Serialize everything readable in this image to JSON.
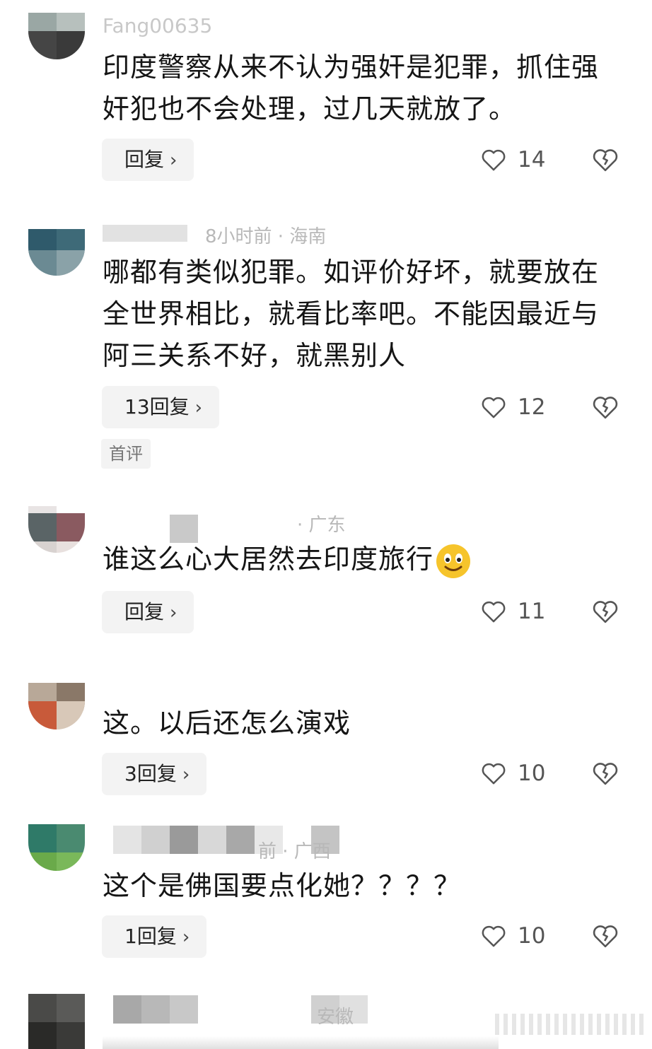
{
  "comments": [
    {
      "username": "Fang00635",
      "meta": "",
      "text": "印度警察从来不认为强奸是犯罪，抓住强奸犯也不会处理，过几天就放了。",
      "reply_label": "回复",
      "like_count": "14",
      "tag": ""
    },
    {
      "username": "",
      "meta": "8小时前 · 海南",
      "text": "哪都有类似犯罪。如评价好坏，就要放在全世界相比，就看比率吧。不能因最近与阿三关系不好，就黑别人",
      "reply_label": "13回复",
      "like_count": "12",
      "tag": "首评"
    },
    {
      "username": "",
      "meta": "· 广东",
      "text": "谁这么心大居然去印度旅行",
      "emoji": "smiling-face",
      "reply_label": "回复",
      "like_count": "11",
      "tag": ""
    },
    {
      "username": "",
      "meta": "",
      "text": "这。以后还怎么演戏",
      "reply_label": "3回复",
      "like_count": "10",
      "tag": ""
    },
    {
      "username": "",
      "meta": "前 · 广西",
      "text": "这个是佛国要点化她？？？？",
      "reply_label": "1回复",
      "like_count": "10",
      "tag": ""
    },
    {
      "username": "",
      "meta": "安徽",
      "text": "",
      "reply_label": "",
      "like_count": "",
      "tag": ""
    }
  ],
  "icons": {
    "like": "heart-outline-icon",
    "dislike": "broken-heart-icon",
    "reply_chevron": "chevron-right-icon"
  },
  "colors": {
    "text": "#151515",
    "meta": "#b8b8b8",
    "button_bg": "#f3f3f3",
    "icon": "#555555"
  }
}
